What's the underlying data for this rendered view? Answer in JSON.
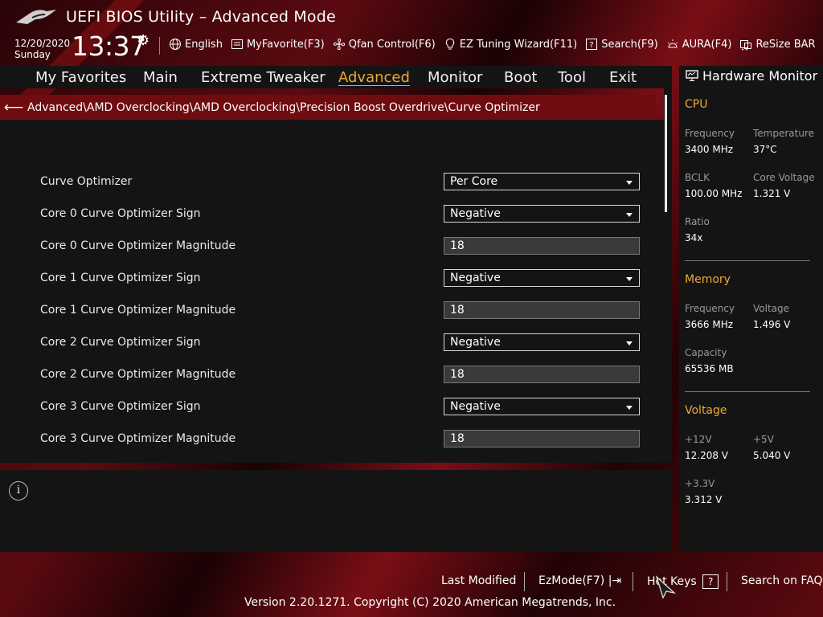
{
  "header": {
    "title": "UEFI BIOS Utility – Advanced Mode",
    "date": "12/20/2020",
    "day": "Sunday",
    "time": "13:37"
  },
  "topbar": {
    "language": "English",
    "myfavorite": "MyFavorite(F3)",
    "qfan": "Qfan Control(F6)",
    "ez_tuning": "EZ Tuning Wizard(F11)",
    "search": "Search(F9)",
    "aura": "AURA(F4)",
    "resize_bar": "ReSize BAR"
  },
  "nav": {
    "tabs": [
      "My Favorites",
      "Main",
      "Extreme Tweaker",
      "Advanced",
      "Monitor",
      "Boot",
      "Tool",
      "Exit"
    ],
    "active": "Advanced"
  },
  "breadcrumb": "Advanced\\AMD Overclocking\\AMD Overclocking\\Precision Boost Overdrive\\Curve Optimizer",
  "settings": [
    {
      "label": "Curve Optimizer",
      "type": "select",
      "value": "Per Core"
    },
    {
      "label": "Core 0 Curve Optimizer Sign",
      "type": "select",
      "value": "Negative"
    },
    {
      "label": "Core 0 Curve Optimizer Magnitude",
      "type": "number",
      "value": "18"
    },
    {
      "label": "Core 1 Curve Optimizer Sign",
      "type": "select",
      "value": "Negative"
    },
    {
      "label": "Core 1 Curve Optimizer Magnitude",
      "type": "number",
      "value": "18"
    },
    {
      "label": "Core 2 Curve Optimizer Sign",
      "type": "select",
      "value": "Negative"
    },
    {
      "label": "Core 2 Curve Optimizer Magnitude",
      "type": "number",
      "value": "18"
    },
    {
      "label": "Core 3 Curve Optimizer Sign",
      "type": "select",
      "value": "Negative"
    },
    {
      "label": "Core 3 Curve Optimizer Magnitude",
      "type": "number",
      "value": "18"
    }
  ],
  "hw_monitor": {
    "title": "Hardware Monitor",
    "cpu": {
      "heading": "CPU",
      "frequency_label": "Frequency",
      "frequency": "3400 MHz",
      "temperature_label": "Temperature",
      "temperature": "37°C",
      "bclk_label": "BCLK",
      "bclk": "100.00 MHz",
      "core_voltage_label": "Core Voltage",
      "core_voltage": "1.321 V",
      "ratio_label": "Ratio",
      "ratio": "34x"
    },
    "memory": {
      "heading": "Memory",
      "frequency_label": "Frequency",
      "frequency": "3666 MHz",
      "voltage_label": "Voltage",
      "voltage": "1.496 V",
      "capacity_label": "Capacity",
      "capacity": "65536 MB"
    },
    "voltage": {
      "heading": "Voltage",
      "v12_label": "+12V",
      "v12": "12.208 V",
      "v5_label": "+5V",
      "v5": "5.040 V",
      "v33_label": "+3.3V",
      "v33": "3.312 V"
    }
  },
  "footer": {
    "last_modified": "Last Modified",
    "ezmode": "EzMode(F7)",
    "hot_keys": "Hot Keys",
    "hot_keys_key": "?",
    "search_faq": "Search on FAQ",
    "version": "Version 2.20.1271. Copyright (C) 2020 American Megatrends, Inc."
  },
  "colors": {
    "accent": "#f0a830",
    "breadcrumb_bg": "#6e0c10",
    "panel_bg": "#141414"
  }
}
